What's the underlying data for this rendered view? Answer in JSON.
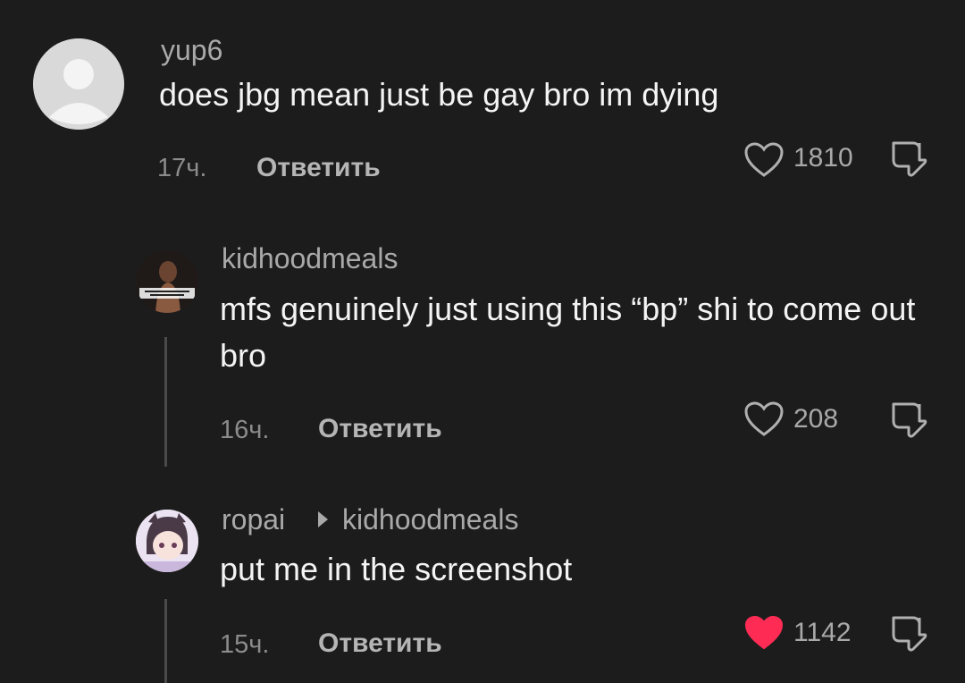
{
  "comments": [
    {
      "username": "yup6",
      "text": "does jbg mean just be gay bro im dying",
      "time": "17ч.",
      "reply_label": "Ответить",
      "likes": "1810",
      "liked": false
    },
    {
      "username": "kidhoodmeals",
      "text": "mfs genuinely just using this “bp” shi to come out bro",
      "time": "16ч.",
      "reply_label": "Ответить",
      "likes": "208",
      "liked": false
    },
    {
      "username": "ropai",
      "reply_to": "kidhoodmeals",
      "text": "put me in the screenshot",
      "time": "15ч.",
      "reply_label": "Ответить",
      "likes": "1142",
      "liked": true
    }
  ],
  "colors": {
    "background": "#1c1c1c",
    "liked_heart": "#fe2c55",
    "muted_text": "#a9a9a9"
  },
  "icons": [
    "default-avatar-icon",
    "heart-outline-icon",
    "heart-filled-icon",
    "dislike-icon",
    "reply-caret-icon"
  ]
}
